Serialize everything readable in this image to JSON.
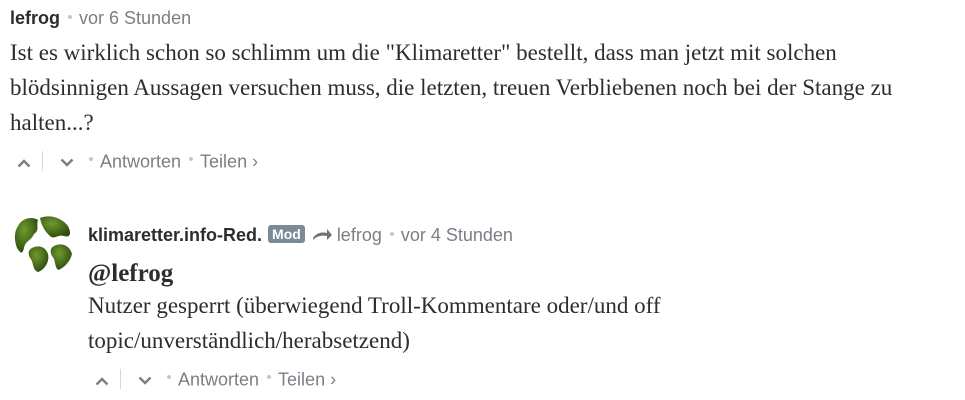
{
  "comments": [
    {
      "author": "lefrog",
      "time": "vor 6 Stunden",
      "text": "Ist es wirklich schon so schlimm um die \"Klimaretter\" bestellt, dass man jetzt mit solchen blödsinnigen Aussagen versuchen muss, die letzten, treuen Verbliebenen noch bei der Stange zu halten...?",
      "reply_label": "Antworten",
      "share_label": "Teilen ›"
    },
    {
      "author": "klimaretter.info-Red.",
      "badge": "Mod",
      "reply_to": "lefrog",
      "time": "vor 4 Stunden",
      "mention": "@lefrog",
      "text": "Nutzer gesperrt (überwiegend Troll-Kommentare oder/und off topic/unverständlich/herabsetzend)",
      "reply_label": "Antworten",
      "share_label": "Teilen ›"
    }
  ],
  "icons": {
    "upvote": "chevron-up-icon",
    "downvote": "chevron-down-icon",
    "reply_arrow": "reply-arrow-icon",
    "avatar": "globe-avatar"
  },
  "colors": {
    "text": "#2a2e2e",
    "muted": "#7a7f85",
    "badge": "#7b8a97",
    "globe_green": "#4f7a1f"
  }
}
